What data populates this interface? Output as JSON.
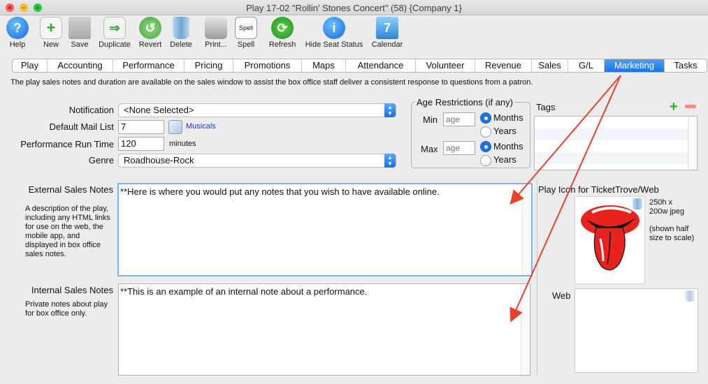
{
  "window": {
    "title": "Play 17-02 \"Rollin' Stones Concert\" (58) {Company 1}"
  },
  "toolbar": {
    "help": "Help",
    "new": "New",
    "save": "Save",
    "duplicate": "Duplicate",
    "revert": "Revert",
    "delete": "Delete",
    "print": "Print...",
    "spell": "Spell",
    "refresh": "Refresh",
    "hide_seat_status": "Hide Seat Status",
    "calendar": "Calendar",
    "spell_icon_text": "Spell",
    "calendar_icon_text": "7"
  },
  "tabs": [
    "Play",
    "Accounting",
    "Performance",
    "Pricing",
    "Promotions",
    "Maps",
    "Attendance",
    "Volunteer",
    "Revenue",
    "Sales",
    "G/L",
    "Marketing",
    "Tasks"
  ],
  "active_tab": "Marketing",
  "info_text": "The play sales notes and duration are available on the sales window to assist the box office staff deliver a consistent response to questions from a patron.",
  "form": {
    "notification_label": "Notification",
    "notification_value": "<None Selected>",
    "mail_list_label": "Default Mail List",
    "mail_list_value": "7",
    "mail_list_name": "Musicals",
    "run_time_label": "Performance Run Time",
    "run_time_value": "120",
    "run_time_unit": "minutes",
    "genre_label": "Genre",
    "genre_value": "Roadhouse-Rock"
  },
  "age": {
    "title": "Age Restrictions (if any)",
    "min_label": "Min",
    "max_label": "Max",
    "placeholder": "age",
    "months": "Months",
    "years": "Years"
  },
  "tags": {
    "label": "Tags"
  },
  "external": {
    "label": "External Sales Notes",
    "desc": "A description of the play, including any HTML links for use on the web, the mobile app, and displayed in box office sales notes.",
    "text": "**Here is where you would put any notes that you wish to have available online."
  },
  "internal": {
    "label": "Internal Sales Notes",
    "desc": "Private notes about play for box office only.",
    "text": "**This is an example of an internal note about a performance."
  },
  "icon": {
    "label": "Play Icon for TicketTrove/Web",
    "size_note": "250h x 200w jpeg",
    "half_note": "(shown half size to scale)",
    "web_label": "Web"
  },
  "colors": {
    "accent": "#1a73e8",
    "arrow": "#e8412c",
    "logo": "#e8231d"
  }
}
